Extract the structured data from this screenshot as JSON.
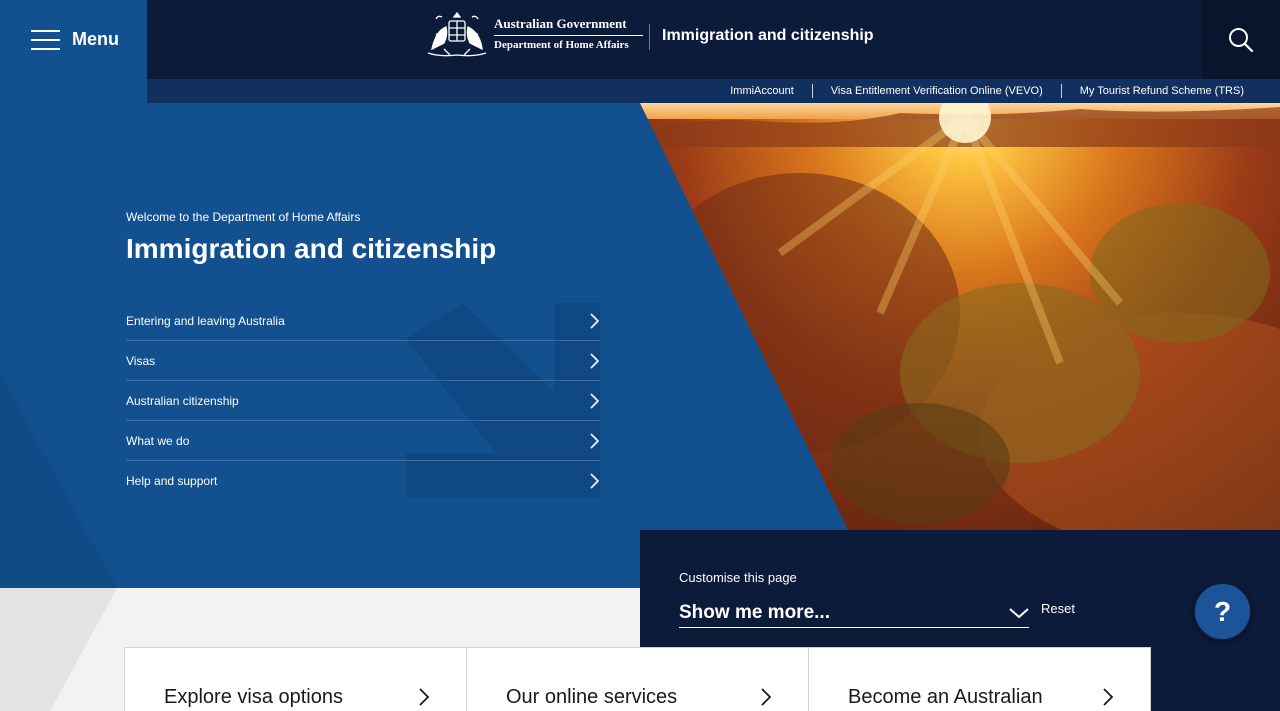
{
  "header": {
    "menu_label": "Menu",
    "gov_line1": "Australian Government",
    "gov_line2": "Department of Home Affairs",
    "site_title": "Immigration and citizenship"
  },
  "quicklinks": [
    "ImmiAccount",
    "Visa Entitlement Verification Online (VEVO)",
    "My Tourist Refund Scheme (TRS)"
  ],
  "hero": {
    "welcome": "Welcome to the Department of Home Affairs",
    "title": "Immigration and citizenship",
    "nav": [
      "Entering and leaving Australia",
      "Visas",
      "Australian citizenship",
      "What we do",
      "Help and support"
    ]
  },
  "customise": {
    "label": "Customise this page",
    "selected": "Show me more...",
    "reset": "Reset",
    "help": "?"
  },
  "cards": [
    "Explore visa options",
    "Our online services",
    "Become an Australian"
  ],
  "colors": {
    "navy": "#0c1b3a",
    "blue": "#12508f",
    "help_button": "#1c5499"
  }
}
